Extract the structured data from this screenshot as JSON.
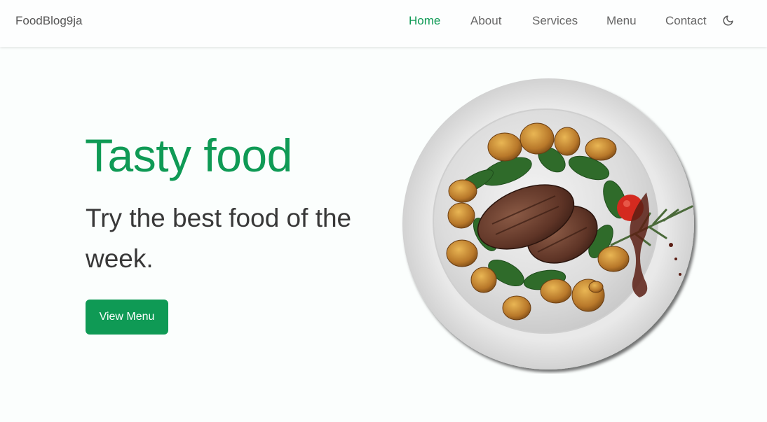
{
  "header": {
    "logo": "FoodBlog9ja",
    "nav": [
      {
        "label": "Home",
        "active": true
      },
      {
        "label": "About",
        "active": false
      },
      {
        "label": "Services",
        "active": false
      },
      {
        "label": "Menu",
        "active": false
      },
      {
        "label": "Contact",
        "active": false
      }
    ],
    "theme_icon": "moon-icon"
  },
  "hero": {
    "title": "Tasty food",
    "subtitle": "Try the best food of the week.",
    "cta_label": "View Menu",
    "image": "plate-of-steak-potatoes-spinach"
  },
  "colors": {
    "accent": "#0f9a55",
    "text": "#383838",
    "nav_text": "#666666",
    "background": "#fbfefd"
  }
}
